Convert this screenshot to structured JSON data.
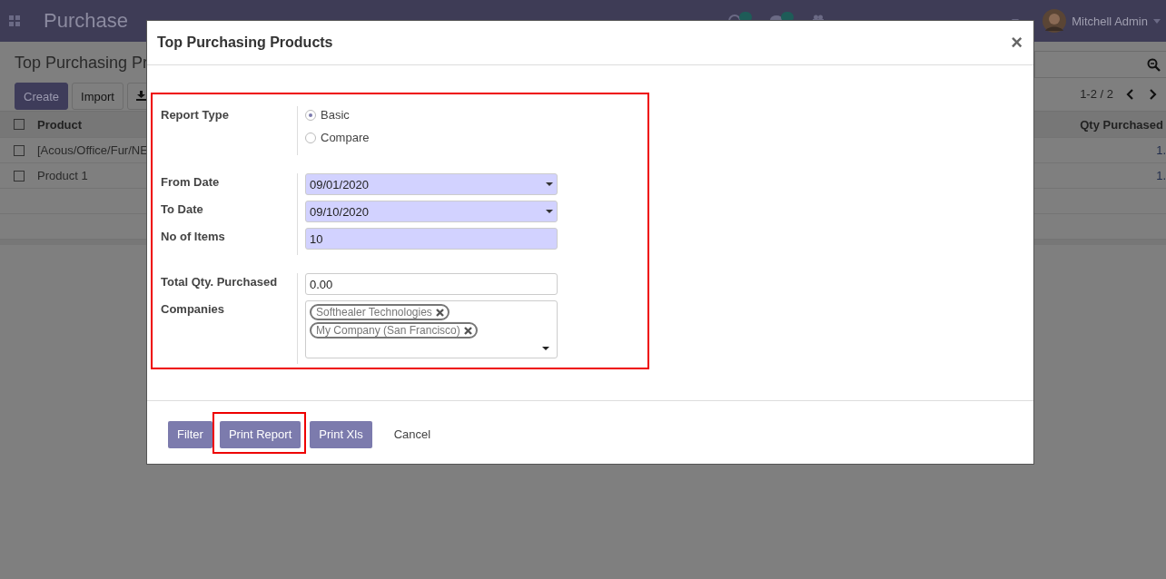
{
  "navbar": {
    "app_name": "Purchase",
    "user": "Mitchell Admin"
  },
  "control_panel": {
    "title": "Top Purchasing Pr",
    "buttons": [
      "Create",
      "Import"
    ],
    "pager": "1-2 / 2"
  },
  "table": {
    "columns": [
      "Product",
      "Qty Purchased"
    ],
    "header_checked": false,
    "rows": [
      {
        "product": "[Acous/Office/Fur/NE",
        "qty": "1.",
        "checked": false
      },
      {
        "product": "Product 1",
        "qty": "1.",
        "checked": false
      }
    ]
  },
  "dialog": {
    "title": "Top Purchasing Products",
    "close": "×",
    "highlighted": true,
    "groups": [
      [
        {
          "label": "Report Type",
          "kind": "radio",
          "options": [
            {
              "label": "Basic",
              "selected": true
            },
            {
              "label": "Compare",
              "selected": false
            }
          ]
        }
      ],
      [
        {
          "label": "From Date",
          "kind": "date",
          "value": "09/01/2020",
          "required": true
        },
        {
          "label": "To Date",
          "kind": "date",
          "value": "09/10/2020",
          "required": true
        },
        {
          "label": "No of Items",
          "kind": "number",
          "value": "10",
          "required": true
        }
      ],
      [
        {
          "label": "Total Qty. Purchased",
          "kind": "number",
          "value": "0.00",
          "required": false
        },
        {
          "label": "Companies",
          "kind": "tags",
          "tags": [
            "Softhealer Technologies",
            "My Company (San Francisco)"
          ]
        }
      ]
    ],
    "buttons": [
      {
        "label": "Filter",
        "kind": "primary",
        "highlighted": false
      },
      {
        "label": "Print Report",
        "kind": "primary",
        "highlighted": true
      },
      {
        "label": "Print Xls",
        "kind": "primary",
        "highlighted": false
      },
      {
        "label": "Cancel",
        "kind": "link",
        "highlighted": false
      }
    ]
  }
}
